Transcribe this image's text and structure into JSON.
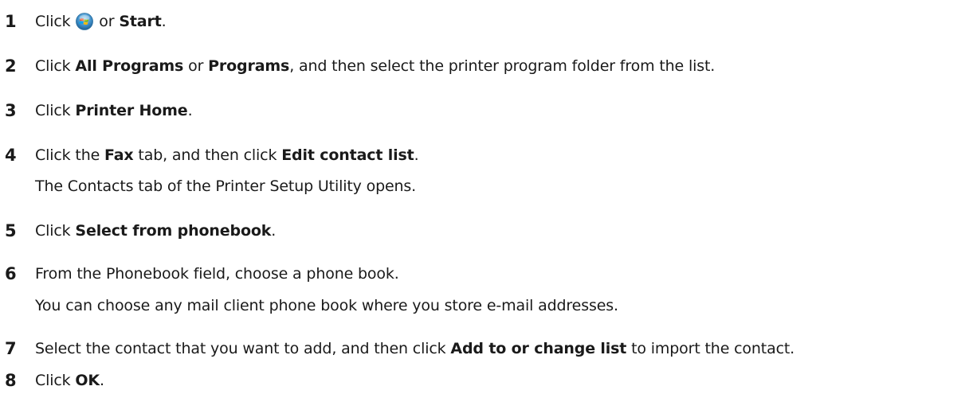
{
  "steps": [
    {
      "number": "1",
      "parts": [
        {
          "text": "Click ",
          "bold": false
        },
        {
          "icon": "windows-start-orb-icon"
        },
        {
          "text": " or ",
          "bold": false
        },
        {
          "text": "Start",
          "bold": true
        },
        {
          "text": ".",
          "bold": false
        }
      ]
    },
    {
      "number": "2",
      "parts": [
        {
          "text": "Click ",
          "bold": false
        },
        {
          "text": "All Programs",
          "bold": true
        },
        {
          "text": " or ",
          "bold": false
        },
        {
          "text": "Programs",
          "bold": true
        },
        {
          "text": ", and then select the printer program folder from the list.",
          "bold": false
        }
      ]
    },
    {
      "number": "3",
      "parts": [
        {
          "text": "Click ",
          "bold": false
        },
        {
          "text": "Printer Home",
          "bold": true
        },
        {
          "text": ".",
          "bold": false
        }
      ]
    },
    {
      "number": "4",
      "parts": [
        {
          "text": "Click the ",
          "bold": false
        },
        {
          "text": "Fax",
          "bold": true
        },
        {
          "text": " tab, and then click ",
          "bold": false
        },
        {
          "text": "Edit contact list",
          "bold": true
        },
        {
          "text": ".",
          "bold": false
        }
      ],
      "note": "The Contacts tab of the Printer Setup Utility opens."
    },
    {
      "number": "5",
      "parts": [
        {
          "text": "Click ",
          "bold": false
        },
        {
          "text": "Select from phonebook",
          "bold": true
        },
        {
          "text": ".",
          "bold": false
        }
      ]
    },
    {
      "number": "6",
      "parts": [
        {
          "text": "From the Phonebook field, choose a phone book.",
          "bold": false
        }
      ],
      "note": "You can choose any mail client phone book where you store e-mail addresses."
    },
    {
      "number": "7",
      "parts": [
        {
          "text": "Select the contact that you want to add, and then click ",
          "bold": false
        },
        {
          "text": "Add to or change list",
          "bold": true
        },
        {
          "text": " to import the contact.",
          "bold": false
        }
      ]
    },
    {
      "number": "8",
      "parts": [
        {
          "text": "Click ",
          "bold": false
        },
        {
          "text": "OK",
          "bold": true
        },
        {
          "text": ".",
          "bold": false
        }
      ]
    }
  ]
}
